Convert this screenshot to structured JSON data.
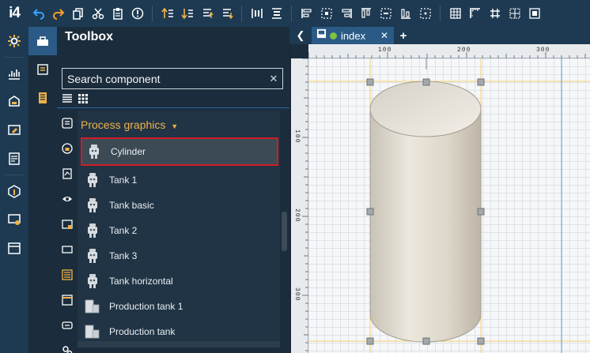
{
  "app": {
    "logo": "i4"
  },
  "toolbox": {
    "title": "Toolbox",
    "search_placeholder": "Search component",
    "group_title": "Process graphics",
    "items": [
      {
        "label": "Cylinder",
        "icon": "robot-icon",
        "selected": true
      },
      {
        "label": "Tank 1",
        "icon": "robot-icon"
      },
      {
        "label": "Tank basic",
        "icon": "robot-icon"
      },
      {
        "label": "Tank 2",
        "icon": "robot-icon"
      },
      {
        "label": "Tank 3",
        "icon": "robot-icon"
      },
      {
        "label": "Tank horizontal",
        "icon": "robot-icon"
      },
      {
        "label": "Production tank 1",
        "icon": "tank-icon"
      },
      {
        "label": "Production tank",
        "icon": "tank-icon"
      }
    ]
  },
  "editor": {
    "tab_name": "index",
    "ruler_x": [
      "100",
      "200",
      "300"
    ],
    "ruler_y": [
      "100",
      "200",
      "300"
    ]
  },
  "colors": {
    "accent_orange": "#f0b24a",
    "selection_red": "#d21c26",
    "status_green": "#7cc142",
    "toolbar_icon_blue": "#3aa0ff",
    "toolbar_icon_orange": "#ff9b2a"
  }
}
